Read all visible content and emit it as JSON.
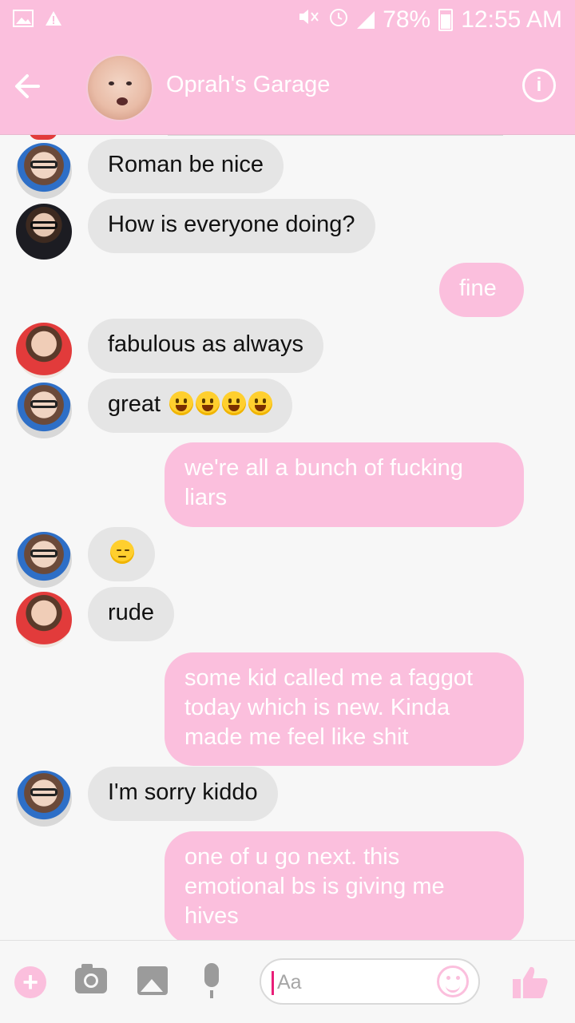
{
  "status_bar": {
    "battery": "78%",
    "time": "12:55 AM"
  },
  "header": {
    "title": "Oprah's Garage"
  },
  "messages": [
    {
      "from": "incoming",
      "avatar": "glasses-hands",
      "text": "Roman be nice"
    },
    {
      "from": "incoming",
      "avatar": "glasses-suit",
      "text": "How is everyone doing?"
    },
    {
      "from": "outgoing",
      "text": "fine"
    },
    {
      "from": "incoming",
      "avatar": "red-shirt",
      "text": "fabulous as always"
    },
    {
      "from": "incoming",
      "avatar": "glasses-hands",
      "text": "great"
    },
    {
      "from": "outgoing",
      "text": "we're all a bunch of fucking liars"
    },
    {
      "from": "incoming",
      "avatar": "glasses-hands",
      "emoji": "pensive"
    },
    {
      "from": "incoming",
      "avatar": "red-shirt",
      "text": "rude"
    },
    {
      "from": "outgoing",
      "text": "some kid called me a faggot today which is new. Kinda made me feel like shit"
    },
    {
      "from": "incoming",
      "avatar": "glasses-hands",
      "text": "I'm sorry kiddo"
    },
    {
      "from": "outgoing",
      "text": "one of u go next. this emotional bs is giving me hives"
    }
  ],
  "composer": {
    "placeholder": "Aa"
  },
  "colors": {
    "accent": "#fbbfdd",
    "incoming_bubble": "#e5e5e5"
  }
}
